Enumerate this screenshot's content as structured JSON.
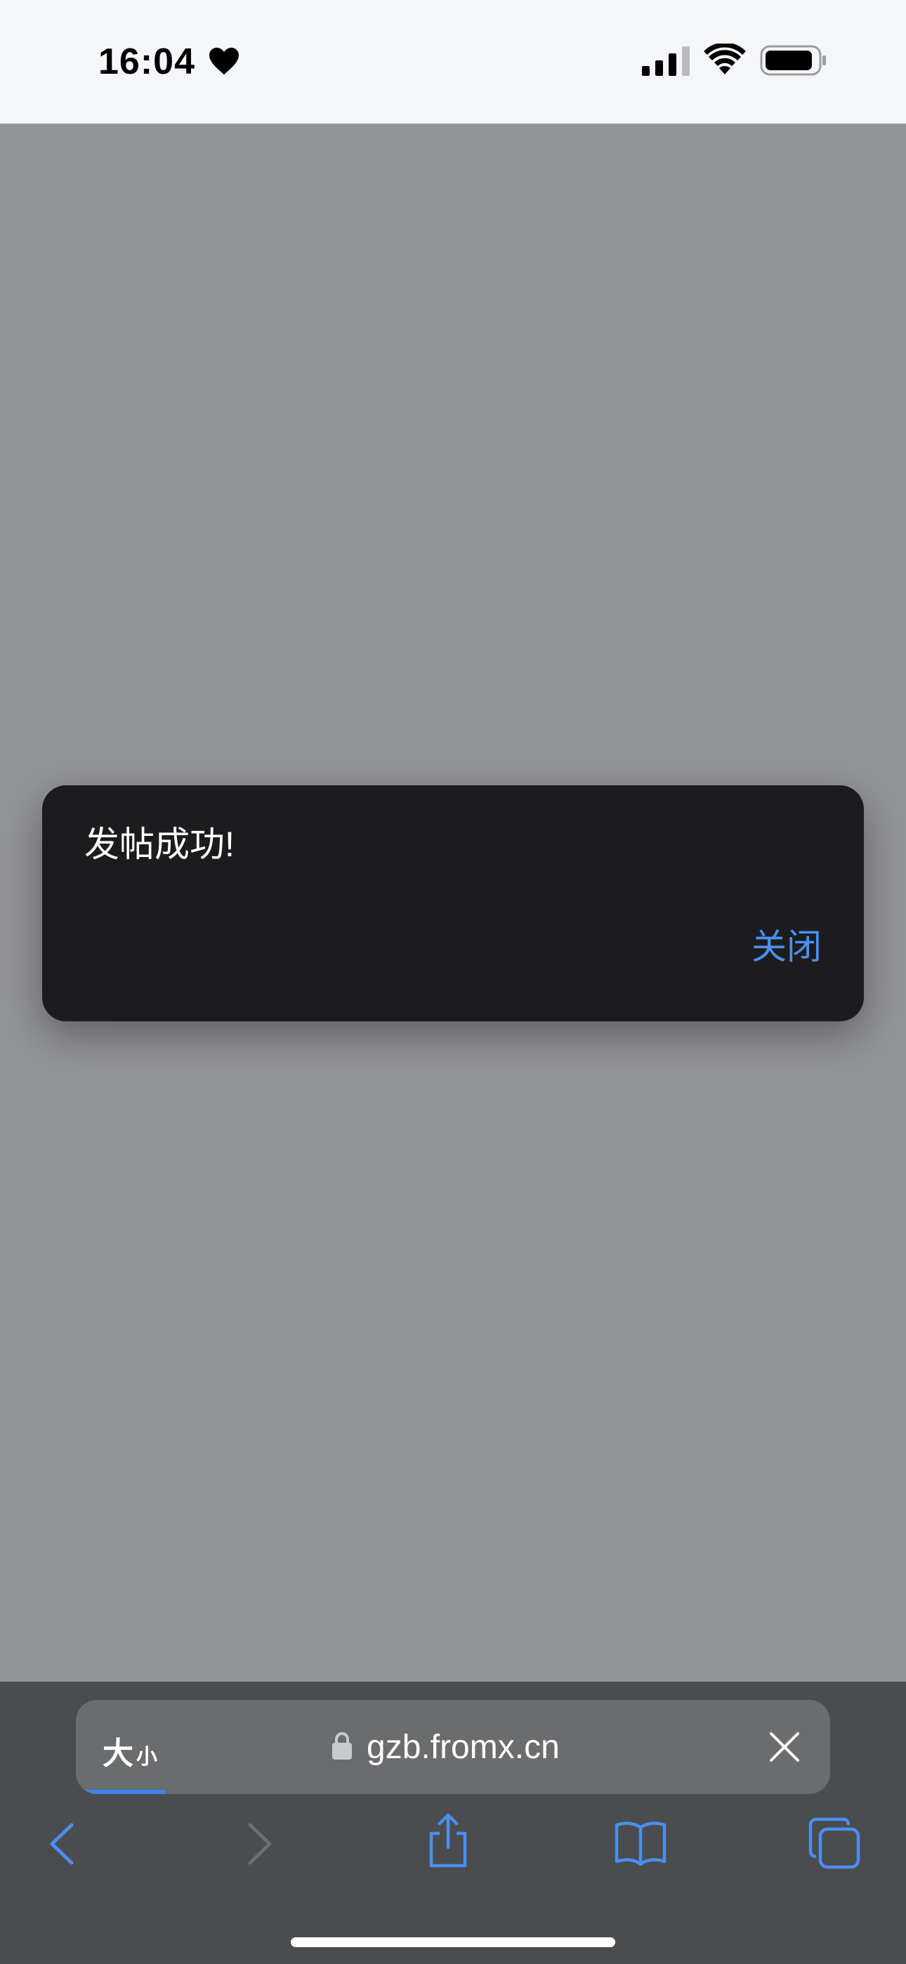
{
  "status_bar": {
    "time": "16:04",
    "icons": [
      "heart-icon",
      "signal-icon",
      "wifi-icon",
      "battery-icon"
    ]
  },
  "alert": {
    "message": "发帖成功!",
    "close_label": "关闭",
    "accent_color": "#4a8ff0"
  },
  "browser": {
    "text_size_big": "大",
    "text_size_small": "小",
    "url": "gzb.fromx.cn",
    "icons": [
      "lock-icon",
      "close-icon",
      "back-icon",
      "forward-icon",
      "share-icon",
      "bookmarks-icon",
      "tabs-icon"
    ]
  },
  "colors": {
    "overlay": "#939496",
    "toolbar": "#4b4c4e",
    "accent": "#3f84f2"
  }
}
